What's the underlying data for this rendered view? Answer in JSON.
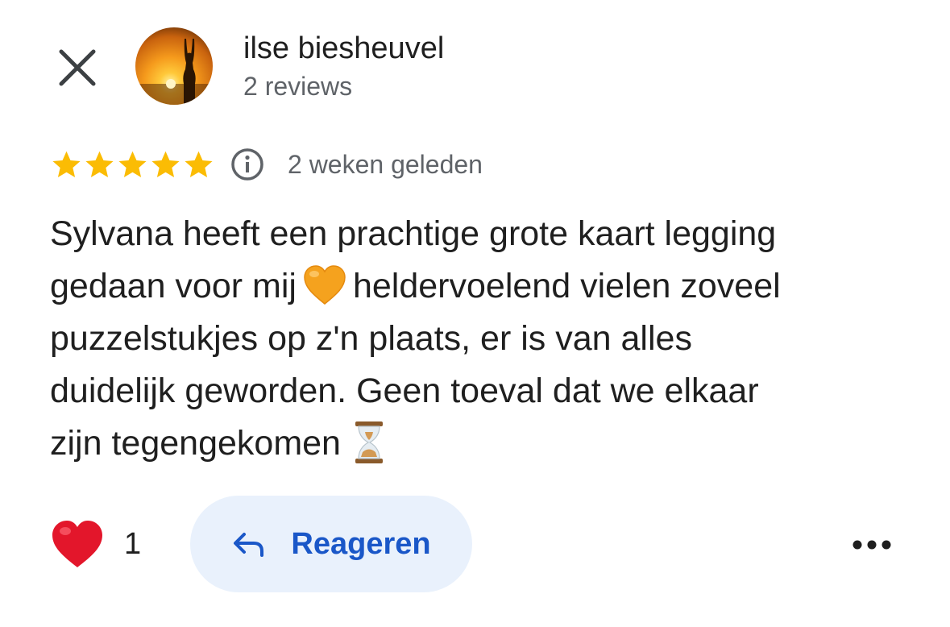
{
  "header": {
    "close_icon": "close-icon",
    "author_name": "ilse biesheuvel",
    "review_count": "2 reviews"
  },
  "rating": {
    "stars": 5,
    "max_stars": 5,
    "star_color": "#fbbc04",
    "info_icon": "info-icon",
    "date": "2 weken geleden"
  },
  "review": {
    "lines": [
      "Sylvana heeft een prachtige grote kaart legging",
      "gedaan voor mij",
      "heldervoelend vielen zoveel",
      "puzzelstukjes op z'n plaats, er is van alles",
      "duidelijk geworden. Geen toeval dat we elkaar",
      "zijn tegengekomen"
    ],
    "emojis": [
      "orange-heart-emoji",
      "hourglass-emoji"
    ]
  },
  "footer": {
    "like_icon": "red-heart-icon",
    "like_count": "1",
    "reply_label": "Reageren",
    "reply_icon": "reply-arrow-icon",
    "more_icon": "more-options-icon",
    "accent_color": "#1a57c8",
    "reply_bg": "#e9f1fc"
  }
}
